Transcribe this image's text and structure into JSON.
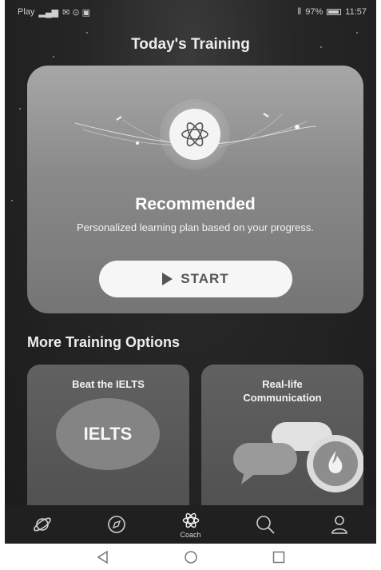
{
  "status_bar": {
    "carrier": "Play",
    "battery": "97%",
    "time": "11:57"
  },
  "title": "Today's Training",
  "recommended": {
    "title": "Recommended",
    "description": "Personalized learning plan based on your progress.",
    "start_label": "START"
  },
  "more_section": {
    "title": "More Training Options",
    "options": [
      {
        "label": "Beat the IELTS",
        "badge": "IELTS"
      },
      {
        "label": "Real-life Communication"
      }
    ]
  },
  "bottom_nav": {
    "items": [
      {
        "icon": "planet-icon"
      },
      {
        "icon": "compass-icon"
      },
      {
        "icon": "coach-icon",
        "label": "Coach",
        "active": true
      },
      {
        "icon": "search-icon"
      },
      {
        "icon": "profile-icon"
      }
    ]
  },
  "colors": {
    "background": "#262626",
    "card": "#898989",
    "button": "#f6f6f6",
    "nav": "#202020"
  }
}
